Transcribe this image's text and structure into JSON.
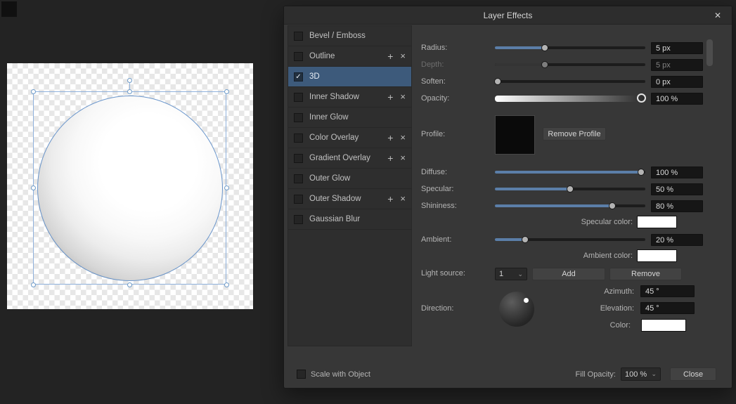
{
  "icons": {
    "close": "✕",
    "chevron_down": "⌄",
    "plus": "+",
    "cross": "×",
    "check": "✓"
  },
  "dialog": {
    "title": "Layer Effects"
  },
  "effects_list": [
    {
      "label": "Bevel / Emboss",
      "checked": false,
      "actions": false,
      "selected": false
    },
    {
      "label": "Outline",
      "checked": false,
      "actions": true,
      "selected": false
    },
    {
      "label": "3D",
      "checked": true,
      "actions": false,
      "selected": true
    },
    {
      "label": "Inner Shadow",
      "checked": false,
      "actions": true,
      "selected": false
    },
    {
      "label": "Inner Glow",
      "checked": false,
      "actions": false,
      "selected": false
    },
    {
      "label": "Color Overlay",
      "checked": false,
      "actions": true,
      "selected": false
    },
    {
      "label": "Gradient Overlay",
      "checked": false,
      "actions": true,
      "selected": false
    },
    {
      "label": "Outer Glow",
      "checked": false,
      "actions": false,
      "selected": false
    },
    {
      "label": "Outer Shadow",
      "checked": false,
      "actions": true,
      "selected": false
    },
    {
      "label": "Gaussian Blur",
      "checked": false,
      "actions": false,
      "selected": false
    }
  ],
  "controls": {
    "radius": {
      "label": "Radius:",
      "value": "5 px",
      "percent": 33
    },
    "depth": {
      "label": "Depth:",
      "value": "5 px",
      "percent": 33
    },
    "soften": {
      "label": "Soften:",
      "value": "0 px",
      "percent": 2
    },
    "opacity": {
      "label": "Opacity:",
      "value": "100 %",
      "percent": 98
    },
    "profile": {
      "label": "Profile:",
      "remove_button": "Remove Profile"
    },
    "diffuse": {
      "label": "Diffuse:",
      "value": "100 %",
      "percent": 97
    },
    "specular": {
      "label": "Specular:",
      "value": "50 %",
      "percent": 50
    },
    "shininess": {
      "label": "Shininess:",
      "value": "80 %",
      "percent": 78
    },
    "specular_color": {
      "label": "Specular color:",
      "color": "#ffffff"
    },
    "ambient": {
      "label": "Ambient:",
      "value": "20 %",
      "percent": 20
    },
    "ambient_color": {
      "label": "Ambient color:",
      "color": "#ffffff"
    },
    "light_source": {
      "label": "Light source:",
      "selected_option": "1",
      "add_button": "Add",
      "remove_button": "Remove"
    },
    "azimuth": {
      "label": "Azimuth:",
      "value": "45 °"
    },
    "elevation": {
      "label": "Elevation:",
      "value": "45 °"
    },
    "direction": {
      "label": "Direction:"
    },
    "light_color": {
      "label": "Color:",
      "color": "#ffffff"
    }
  },
  "footer": {
    "scale_with_object_label": "Scale with Object",
    "fill_opacity_label": "Fill Opacity:",
    "fill_opacity_value": "100 %",
    "close_button": "Close"
  },
  "colors": {
    "accent_blue": "#5b7ea8",
    "selection_blue": "#3d5a7b",
    "profile_swatch": "#0a0a0a"
  }
}
